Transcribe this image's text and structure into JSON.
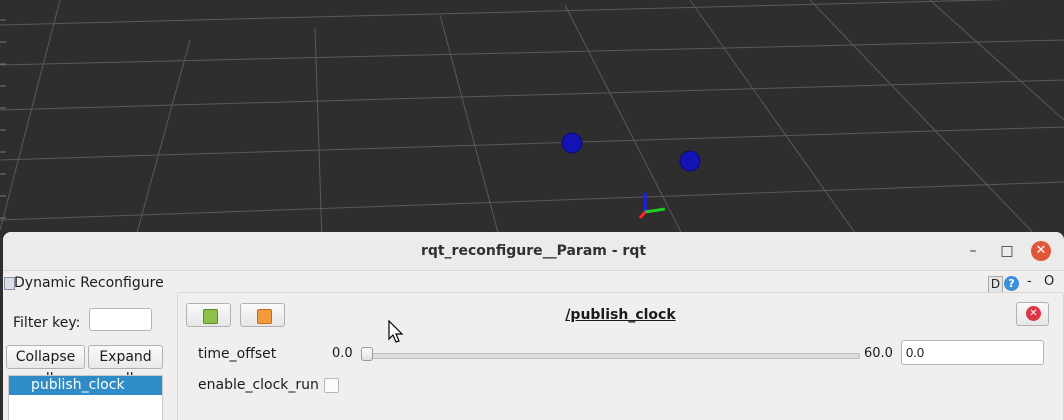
{
  "window": {
    "title": "rqt_reconfigure__Param - rqt",
    "minimize": "–",
    "maximize": "□",
    "close": "✕"
  },
  "plugin": {
    "title": "Dynamic Reconfigure",
    "d_label": "D",
    "help_label": "?",
    "min_label": "-",
    "float_label": "O"
  },
  "filter": {
    "label": "Filter key:",
    "value": ""
  },
  "buttons": {
    "collapse_all": "Collapse all",
    "expand_all": "Expand all"
  },
  "tree": {
    "items": [
      {
        "label": "publish_clock",
        "selected": true
      }
    ]
  },
  "node": {
    "name": "/publish_clock"
  },
  "params": {
    "time_offset": {
      "label": "time_offset",
      "min": "0.0",
      "max": "60.0",
      "value": "0.0",
      "fraction": 0.0
    },
    "enable_clock_run": {
      "label": "enable_clock_run",
      "checked": false
    }
  },
  "colors": {
    "viewport_bg": "#2e2e2e",
    "selection": "#308cc6",
    "close_red": "#e05638"
  }
}
